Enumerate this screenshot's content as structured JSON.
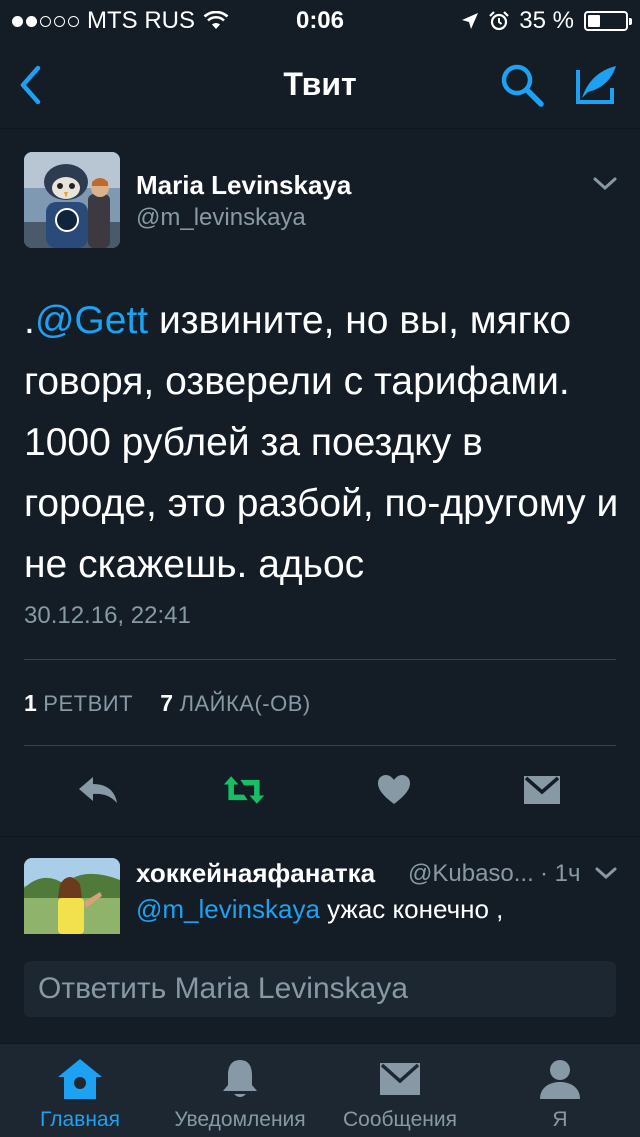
{
  "status_bar": {
    "carrier": "MTS RUS",
    "time": "0:06",
    "battery": "35 %",
    "signal_bars_filled": 2,
    "signal_bars_total": 5
  },
  "nav": {
    "title": "Твит",
    "back_icon": "chevron-left-icon",
    "search_icon": "search-icon",
    "compose_icon": "compose-tweet-icon"
  },
  "tweet": {
    "author_name": "Maria Levinskaya",
    "author_handle": "@m_levinskaya",
    "text_prefix": ".",
    "mention": "@Gett",
    "text_body": " извините, но вы, мягко говоря, озверели с тарифами. 1000 рублей за поездку в городе, это разбой, по-другому и не скажешь. адьос",
    "timestamp": "30.12.16, 22:41",
    "retweet_count": "1",
    "retweet_label": "РЕТВИТ",
    "like_count": "7",
    "like_label": "ЛАЙКА(-ОВ)"
  },
  "actions": {
    "reply_icon": "reply-icon",
    "retweet_icon": "retweet-icon",
    "like_icon": "heart-icon",
    "dm_icon": "envelope-icon"
  },
  "reply_tweet": {
    "author_name": "хоккейнаяфанатка",
    "author_handle": "@Kubaso...",
    "time": "· 1ч",
    "mention": "@m_levinskaya",
    "text": " ужас конечно ,"
  },
  "compose": {
    "placeholder": "Ответить Maria Levinskaya"
  },
  "tabs": [
    {
      "label": "Главная",
      "icon": "home-icon",
      "active": true
    },
    {
      "label": "Уведомления",
      "icon": "bell-icon",
      "active": false
    },
    {
      "label": "Сообщения",
      "icon": "envelope-icon",
      "active": false
    },
    {
      "label": "Я",
      "icon": "person-icon",
      "active": false
    }
  ],
  "colors": {
    "background": "#141d26",
    "accent": "#1da1f2",
    "secondary_text": "#8899a6",
    "retweet_green": "#17bf63"
  }
}
